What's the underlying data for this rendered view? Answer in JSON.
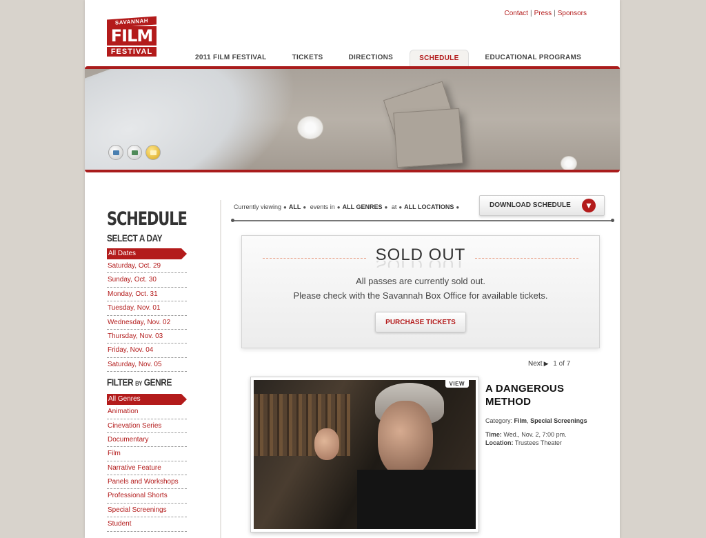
{
  "header": {
    "logo": {
      "top": "SAVANNAH",
      "middle": "FILM",
      "bottom": "FESTIVAL"
    },
    "top_links": [
      "Contact",
      "Press",
      "Sponsors"
    ],
    "nav": [
      {
        "label": "2011 FILM FESTIVAL"
      },
      {
        "label": "TICKETS"
      },
      {
        "label": "DIRECTIONS"
      },
      {
        "label": "SCHEDULE",
        "active": true
      },
      {
        "label": "EDUCATIONAL PROGRAMS"
      }
    ]
  },
  "banner": {
    "slide_count": 3,
    "active_slide": 3
  },
  "sidebar": {
    "title": "SCHEDULE",
    "select_day": "SELECT A DAY",
    "days_active": "All Dates",
    "days": [
      "Saturday, Oct. 29",
      "Sunday, Oct. 30",
      "Monday, Oct. 31",
      "Tuesday, Nov. 01",
      "Wednesday, Nov. 02",
      "Thursday, Nov. 03",
      "Friday, Nov. 04",
      "Saturday, Nov. 05"
    ],
    "filter_word": "FILTER",
    "filter_by": "BY",
    "filter_genre": "GENRE",
    "genres_active": "All Genres",
    "genres": [
      "Animation",
      "Cinevation Series",
      "Documentary",
      "Film",
      "Narrative Feature",
      "Panels and Workshops",
      "Professional Shorts",
      "Special Screenings",
      "Student"
    ]
  },
  "filters": {
    "currently_viewing": "Currently viewing",
    "all": "ALL",
    "events_in": "events in",
    "genre": "ALL GENRES",
    "at": "at",
    "location": "ALL LOCATIONS",
    "download_label": "DOWNLOAD SCHEDULE"
  },
  "soldout": {
    "title": "SOLD OUT",
    "line1": "All passes are currently sold out.",
    "line2": "Please check with the Savannah Box Office for available tickets.",
    "button": "PURCHASE TICKETS"
  },
  "pager": {
    "next": "Next",
    "current": "1",
    "of": "of",
    "total": "7"
  },
  "film": {
    "view_label": "VIEW",
    "title": "A DANGEROUS METHOD",
    "category_label": "Category:",
    "category_1": "Film",
    "category_2": "Special Screenings",
    "time_label": "Time:",
    "time_value": "Wed., Nov. 2, 7:00 pm.",
    "location_label": "Location:",
    "location_value": "Trustees Theater"
  },
  "colors": {
    "brand_red": "#b31b1b",
    "page_bg": "#d8d3cc"
  }
}
